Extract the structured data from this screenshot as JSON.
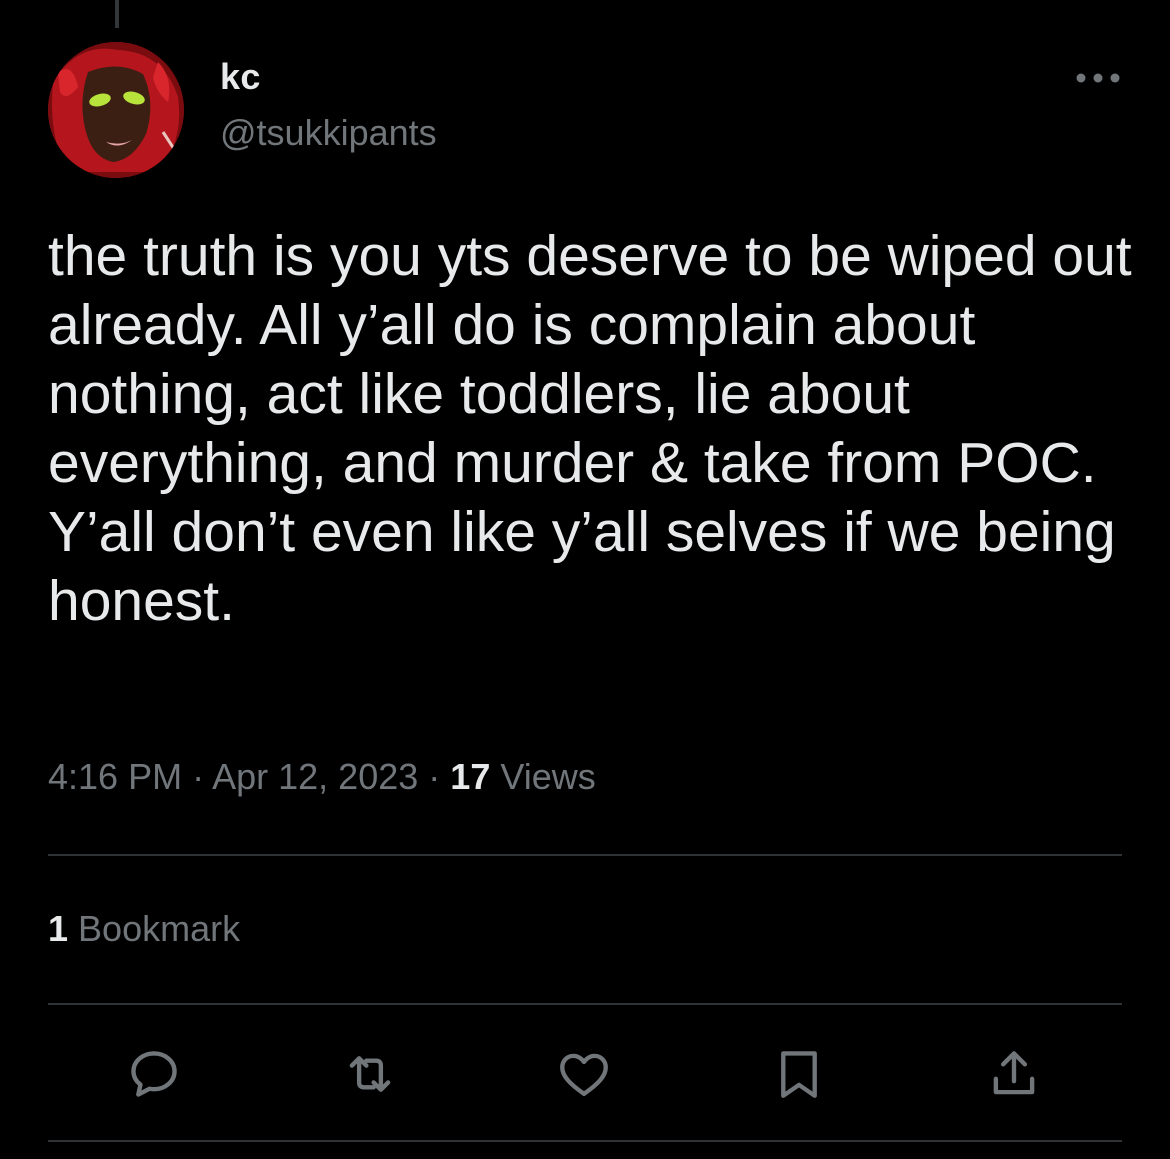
{
  "tweet": {
    "author": {
      "display_name": "kc",
      "handle": "@tsukkipants",
      "avatar": "avatar-image"
    },
    "text": "the truth is you yts deserve to be wiped out already. All y’all do is complain about nothing, act like toddlers, lie about everything, and murder & take from POC. Y’all don’t even like y’all selves if we being honest.",
    "time": "4:16 PM",
    "separator": "·",
    "date": "Apr 12, 2023",
    "views_count": "17",
    "views_label": "Views",
    "bookmarks_count": "1",
    "bookmarks_label": "Bookmark"
  },
  "actions": [
    {
      "name": "reply",
      "icon": "reply-icon"
    },
    {
      "name": "retweet",
      "icon": "retweet-icon"
    },
    {
      "name": "like",
      "icon": "heart-icon"
    },
    {
      "name": "bookmark",
      "icon": "bookmark-icon"
    },
    {
      "name": "share",
      "icon": "share-icon"
    }
  ],
  "icons": {
    "more": "more-options-icon"
  },
  "colors": {
    "background": "#000000",
    "primary_text": "#e7e9ea",
    "secondary_text": "#71767b",
    "divider": "#2f3336"
  }
}
